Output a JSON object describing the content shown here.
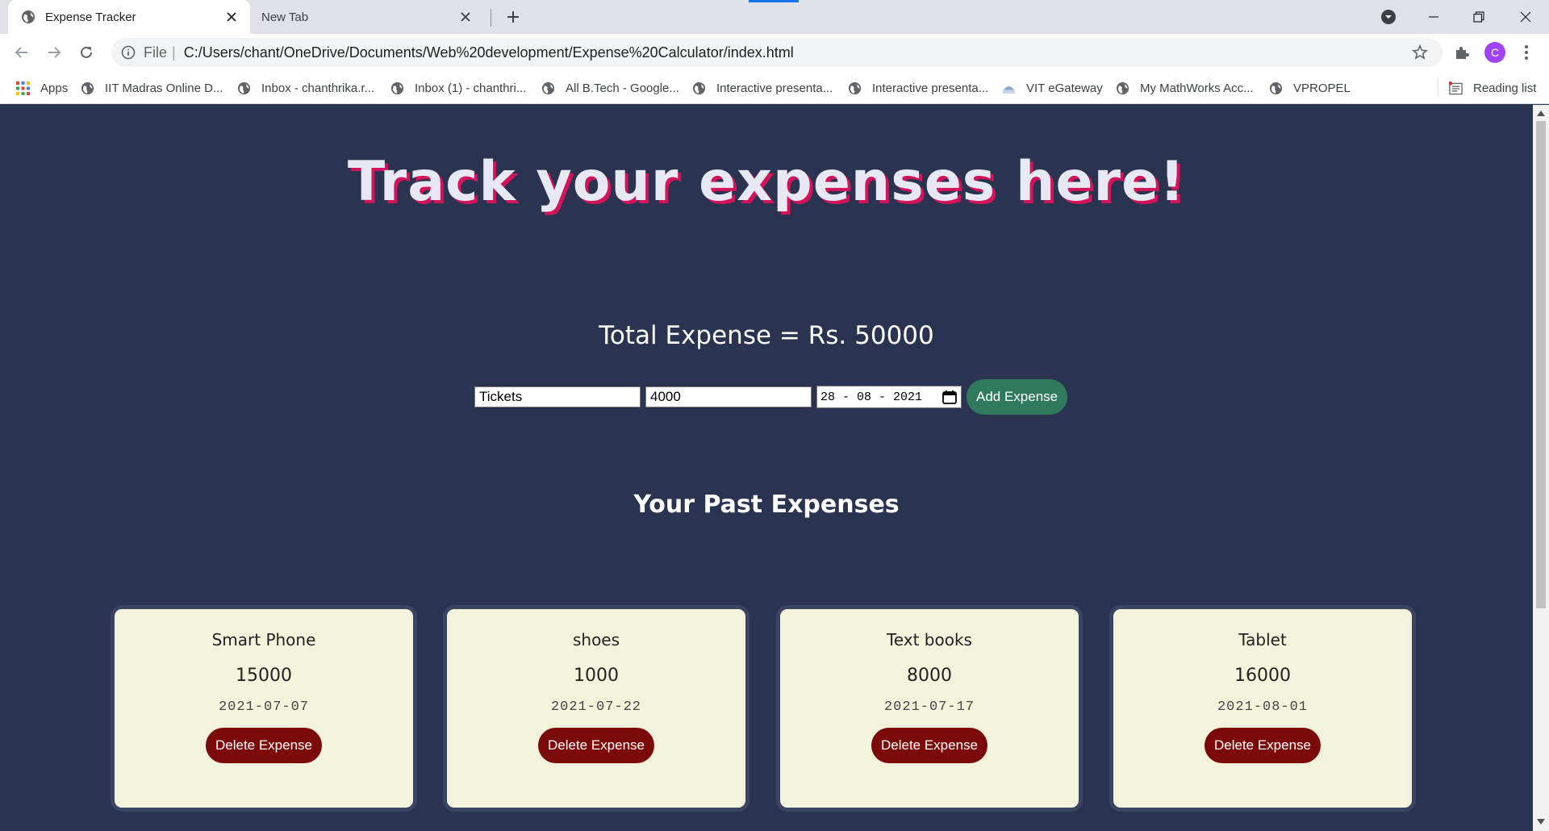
{
  "browser": {
    "tabs": [
      {
        "title": "Expense Tracker",
        "active": true
      },
      {
        "title": "New Tab",
        "active": false
      }
    ],
    "address": {
      "scheme": "File",
      "url": "C:/Users/chant/OneDrive/Documents/Web%20development/Expense%20Calculator/index.html"
    },
    "profile_initial": "C",
    "bookmarks": [
      {
        "label": "Apps",
        "icon": "apps-grid-icon"
      },
      {
        "label": "IIT Madras Online D...",
        "icon": "globe-icon"
      },
      {
        "label": "Inbox - chanthrika.r...",
        "icon": "globe-icon"
      },
      {
        "label": "Inbox (1) - chanthri...",
        "icon": "globe-icon"
      },
      {
        "label": "All B.Tech - Google...",
        "icon": "globe-icon"
      },
      {
        "label": "Interactive presenta...",
        "icon": "globe-icon"
      },
      {
        "label": "Interactive presenta...",
        "icon": "globe-icon"
      },
      {
        "label": "VIT eGateway",
        "icon": "vit-logo-icon"
      },
      {
        "label": "My MathWorks Acc...",
        "icon": "globe-icon"
      },
      {
        "label": "VPROPEL",
        "icon": "globe-icon"
      }
    ],
    "reading_list": "Reading list"
  },
  "page": {
    "title": "Track your expenses here!",
    "total_text": "Total Expense = Rs. 50000",
    "form": {
      "name_value": "Tickets",
      "amount_value": "4000",
      "date_value": "28 - 08 - 2021",
      "add_label": "Add Expense"
    },
    "past_heading": "Your Past Expenses",
    "expenses": [
      {
        "name": "Smart Phone",
        "amount": "15000",
        "date": "2021-07-07",
        "delete_label": "Delete Expense"
      },
      {
        "name": "shoes",
        "amount": "1000",
        "date": "2021-07-22",
        "delete_label": "Delete Expense"
      },
      {
        "name": "Text books",
        "amount": "8000",
        "date": "2021-07-17",
        "delete_label": "Delete Expense"
      },
      {
        "name": "Tablet",
        "amount": "16000",
        "date": "2021-08-01",
        "delete_label": "Delete Expense"
      }
    ]
  },
  "colors": {
    "page_bg": "#2a3350",
    "title_shadow": "#d4145a",
    "add_button": "#2f7a5c",
    "delete_button": "#7d0a0a",
    "card_bg": "#f3f3dc"
  }
}
